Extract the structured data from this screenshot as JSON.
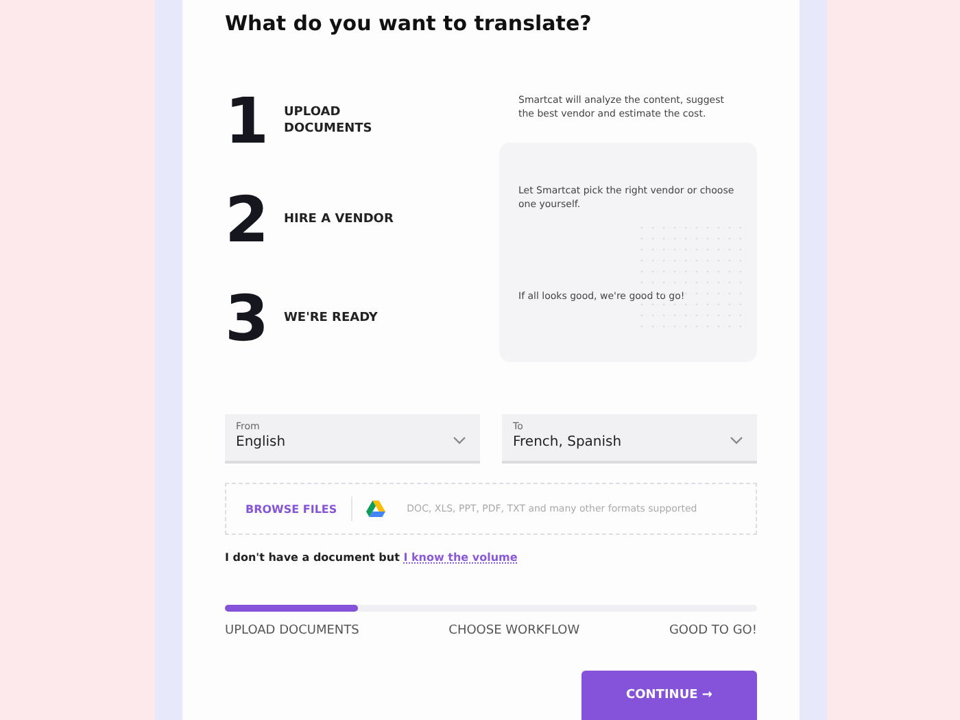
{
  "title": "What do you want to translate?",
  "steps": [
    {
      "number": "1",
      "label": "UPLOAD DOCUMENTS",
      "description": "Smartcat will analyze the content, suggest the best vendor and estimate the cost."
    },
    {
      "number": "2",
      "label": "HIRE A VENDOR",
      "description": "Let Smartcat pick the right vendor or choose one yourself."
    },
    {
      "number": "3",
      "label": "WE'RE READY",
      "description": "If all looks good, we're good to go!"
    }
  ],
  "languages": [
    {
      "label": "From",
      "value": "English"
    },
    {
      "label": "To",
      "value": "French, Spanish"
    }
  ],
  "upload": {
    "button": "BROWSE FILES",
    "hint": "DOC, XLS, PPT, PDF, TXT and many other formats supported"
  },
  "volume": {
    "text": "I don't have a document but",
    "link": "I know the volume"
  },
  "progress": {
    "level": 0.25,
    "labels": [
      "UPLOAD DOCUMENTS",
      "CHOOSE WORKFLOW",
      "GOOD TO GO!"
    ]
  },
  "continue_button": "CONTINUE →"
}
